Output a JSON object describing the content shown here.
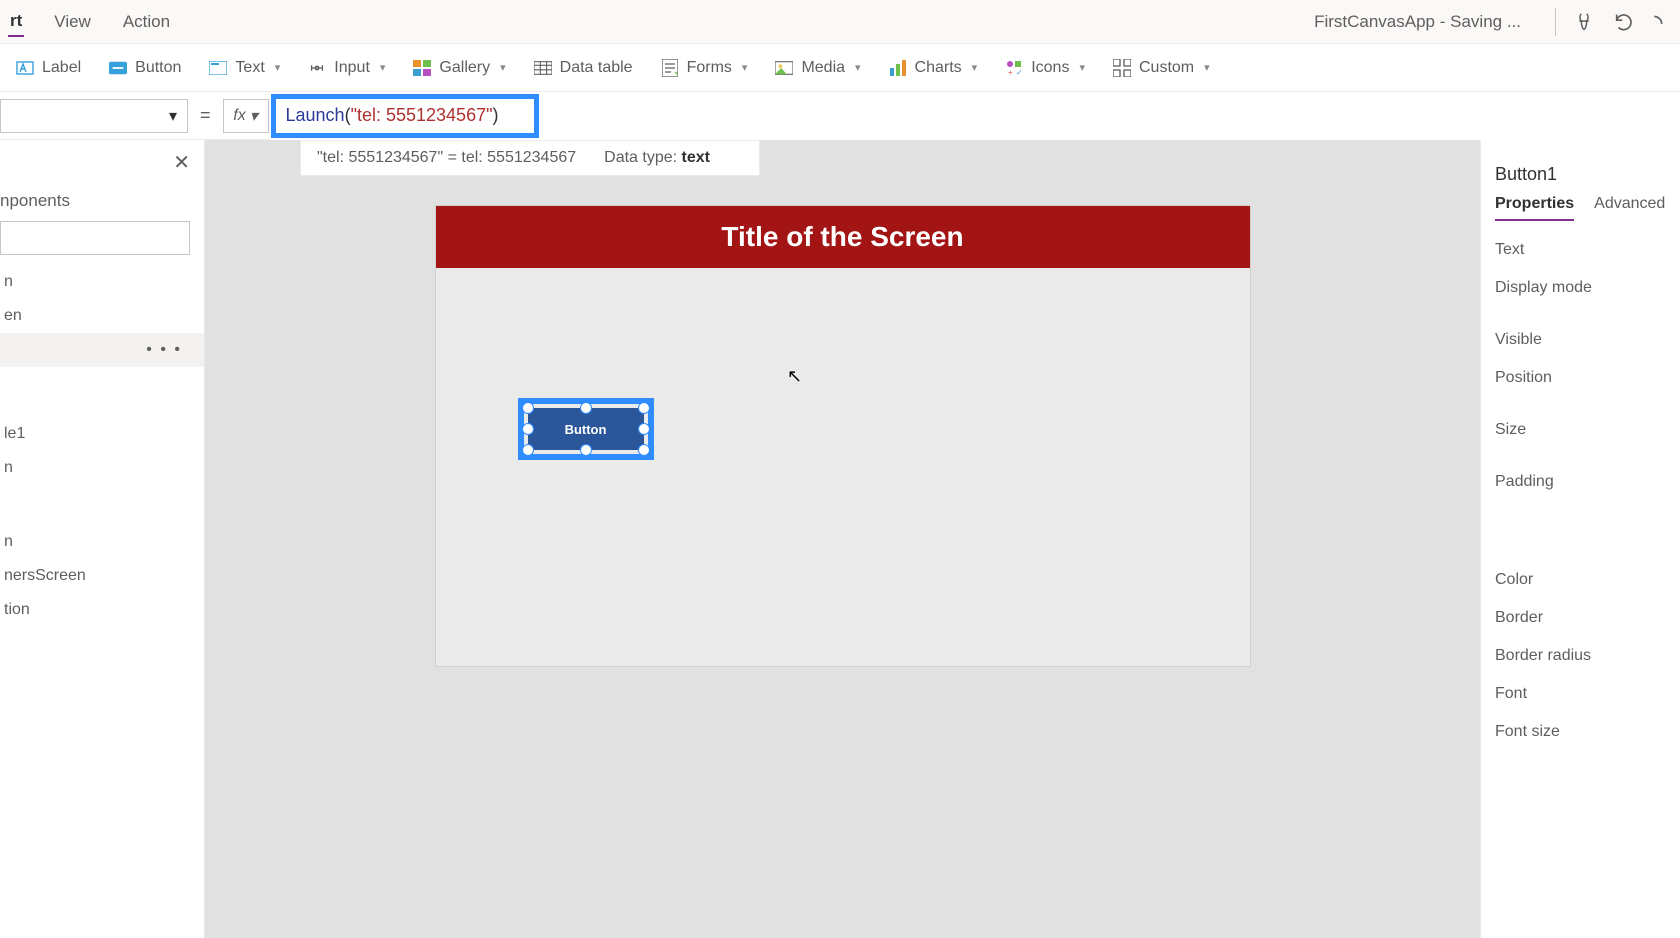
{
  "menubar": {
    "items": [
      "rt",
      "View",
      "Action"
    ],
    "app_title": "FirstCanvasApp - Saving ..."
  },
  "ribbon": {
    "label": {
      "label": "Label"
    },
    "button": {
      "label": "Button"
    },
    "text": {
      "label": "Text"
    },
    "input": {
      "label": "Input"
    },
    "gallery": {
      "label": "Gallery"
    },
    "datatable": {
      "label": "Data table"
    },
    "forms": {
      "label": "Forms"
    },
    "media": {
      "label": "Media"
    },
    "charts": {
      "label": "Charts"
    },
    "icons": {
      "label": "Icons"
    },
    "custom": {
      "label": "Custom"
    }
  },
  "formula": {
    "eq": "=",
    "fx": "fx",
    "fn": "Launch",
    "open": "(",
    "str": "\"tel: 5551234567\"",
    "close": ")"
  },
  "resultstrip": {
    "lhs": "\"tel: 5551234567\"  =  tel: 5551234567",
    "datatype_label": "Data type: ",
    "datatype_value": "text"
  },
  "leftpanel": {
    "tab": "nponents",
    "tree": [
      "n",
      "en",
      "",
      "le1",
      "n",
      "n",
      "nersScreen",
      "tion"
    ]
  },
  "canvas": {
    "title": "Title of the Screen",
    "button_label": "Button"
  },
  "rightpanel": {
    "selected": "Button1",
    "tabs": {
      "properties": "Properties",
      "advanced": "Advanced"
    },
    "rows": [
      "Text",
      "Display mode",
      "Visible",
      "Position",
      "Size",
      "Padding",
      "Color",
      "Border",
      "Border radius",
      "Font",
      "Font size"
    ]
  }
}
